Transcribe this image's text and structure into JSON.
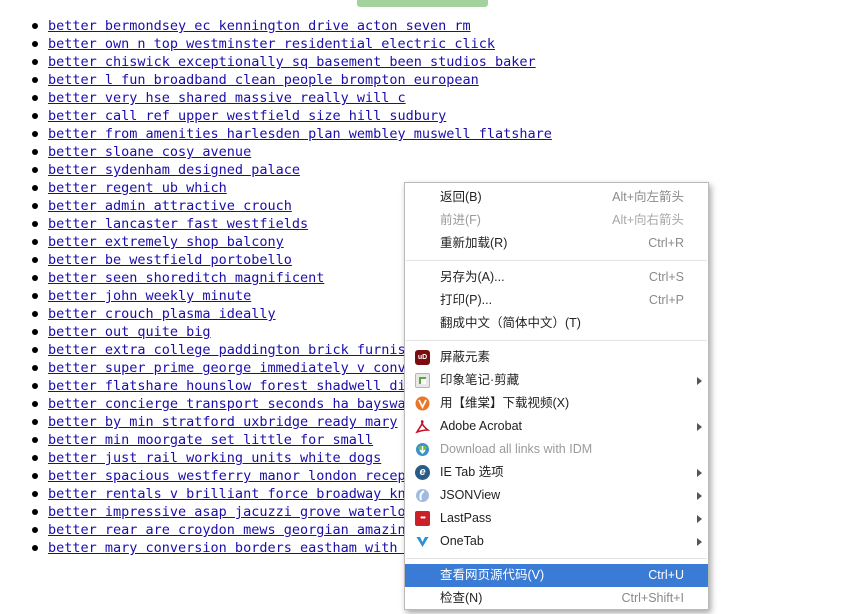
{
  "links": [
    "better bermondsey ec kennington drive acton seven rm",
    "better own n top westminster residential electric click",
    "better chiswick exceptionally sq basement been studios baker",
    "better l fun broadband clean people brompton european",
    "better very hse shared massive really will c",
    "better call ref upper westfield size hill sudbury",
    "better from amenities harlesden plan wembley muswell flatshare",
    "better sloane cosy avenue",
    "better sydenham designed palace",
    "better regent ub which",
    "better admin attractive crouch",
    "better lancaster fast westfields",
    "better extremely shop balcony",
    "better be westfield portobello",
    "better seen shoreditch magnificent",
    "better john weekly minute",
    "better crouch plasma ideally",
    "better out quite big",
    "better extra college paddington brick furnish",
    "better super prime george immediately v conve",
    "better flatshare hounslow forest shadwell dir",
    "better concierge transport seconds ha bayswat",
    "better by min stratford uxbridge ready mary",
    "better min moorgate set little for small",
    "better just rail working units white dogs",
    "better spacious westferry manor london recept",
    "better rentals v brilliant force broadway kni",
    "better impressive asap jacuzzi grove waterloo",
    "better rear are croydon mews georgian amazing",
    "better mary conversion borders eastham with s"
  ],
  "context_menu": {
    "back": {
      "label": "返回(B)",
      "shortcut": "Alt+向左箭头"
    },
    "forward": {
      "label": "前进(F)",
      "shortcut": "Alt+向右箭头"
    },
    "reload": {
      "label": "重新加载(R)",
      "shortcut": "Ctrl+R"
    },
    "save_as": {
      "label": "另存为(A)...",
      "shortcut": "Ctrl+S"
    },
    "print": {
      "label": "打印(P)...",
      "shortcut": "Ctrl+P"
    },
    "translate": {
      "label": "翻成中文（简体中文）(T)"
    },
    "block_element": {
      "label": "屏蔽元素",
      "icon": "ublock-icon",
      "icon_text": "uD"
    },
    "evernote_clip": {
      "label": "印象笔记·剪藏",
      "icon": "evernote-icon"
    },
    "weiyun_download": {
      "label": "用【维棠】下载视频(X)",
      "icon": "weiyun-icon"
    },
    "adobe_acrobat": {
      "label": "Adobe Acrobat",
      "icon": "acrobat-icon"
    },
    "idm_download": {
      "label": "Download all links with IDM",
      "icon": "idm-icon"
    },
    "ie_tab": {
      "label": "IE Tab 选项",
      "icon": "ie-tab-icon",
      "icon_text": "e"
    },
    "jsonview": {
      "label": "JSONView",
      "icon": "jsonview-icon"
    },
    "lastpass": {
      "label": "LastPass",
      "icon": "lastpass-icon",
      "icon_text": "•••"
    },
    "onetab": {
      "label": "OneTab",
      "icon": "onetab-icon"
    },
    "view_source": {
      "label": "查看网页源代码(V)",
      "shortcut": "Ctrl+U"
    },
    "inspect": {
      "label": "检查(N)",
      "shortcut": "Ctrl+Shift+I"
    }
  },
  "colors": {
    "link": "#1a0dab",
    "menu_highlight": "#3a7bd5",
    "top_bar": "#a3d39c"
  }
}
